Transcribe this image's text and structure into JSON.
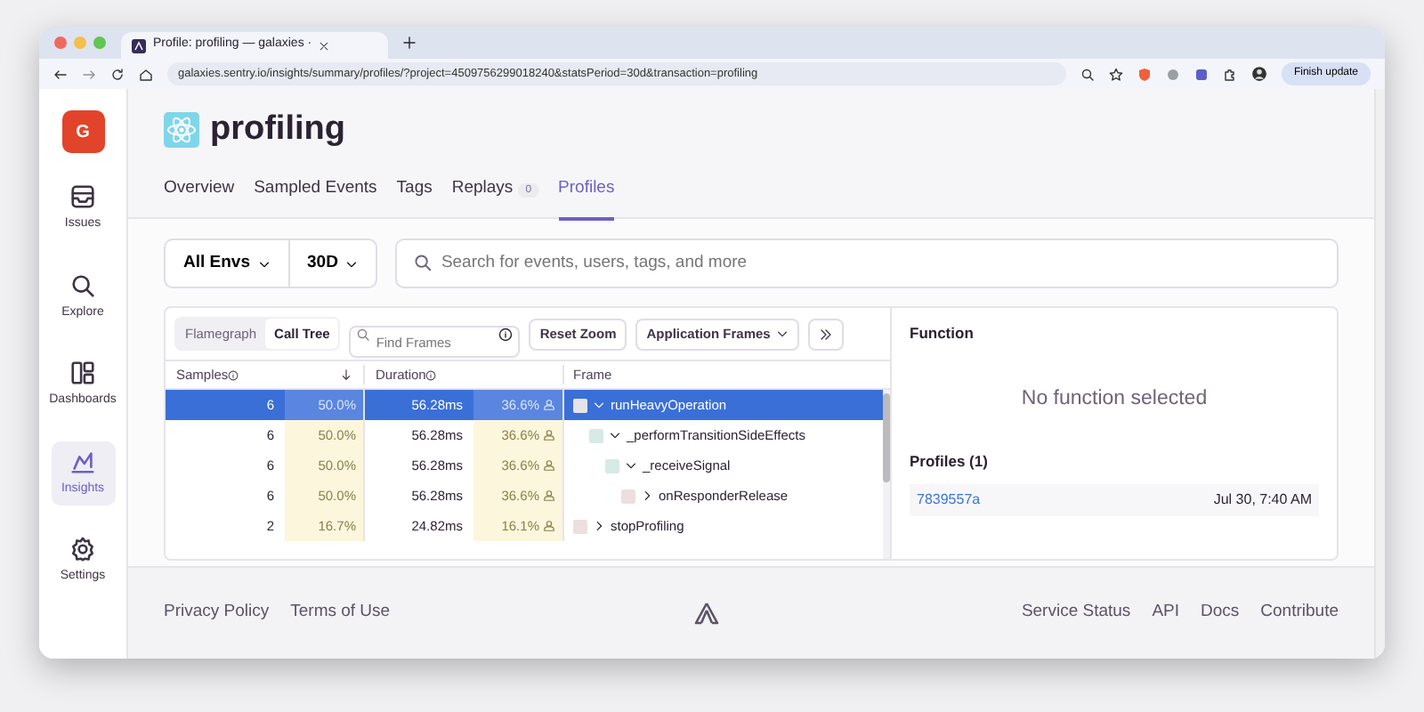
{
  "browser": {
    "tab_title": "Profile: profiling — galaxies ·",
    "address": "galaxies.sentry.io/insights/summary/profiles/?project=4509756299018240&statsPeriod=30d&transaction=profiling",
    "update_button": "Finish update"
  },
  "sidebar": {
    "org": "G",
    "items": [
      {
        "label": "Issues",
        "kind": "inbox",
        "selected": false
      },
      {
        "label": "Explore",
        "kind": "search",
        "selected": false
      },
      {
        "label": "Dashboards",
        "kind": "dashboard",
        "selected": false
      },
      {
        "label": "Insights",
        "kind": "chart",
        "selected": true
      },
      {
        "label": "Settings",
        "kind": "settings",
        "selected": false
      }
    ]
  },
  "page": {
    "title": "profiling",
    "tabs": [
      {
        "label": "Overview",
        "selected": false
      },
      {
        "label": "Sampled Events",
        "selected": false
      },
      {
        "label": "Tags",
        "selected": false
      },
      {
        "label": "Replays",
        "badge": "0",
        "selected": false
      },
      {
        "label": "Profiles",
        "selected": true
      }
    ]
  },
  "filters": {
    "environment": "All Envs",
    "period": "30D",
    "search": {
      "placeholder": "Search for events, users, tags, and more"
    }
  },
  "toolbar": {
    "views": [
      {
        "label": "Flamegraph",
        "selected": false
      },
      {
        "label": "Call Tree",
        "selected": true
      }
    ],
    "find": {
      "placeholder": "Find Frames"
    },
    "reset_button": "Reset Zoom",
    "frames_dropdown": "Application Frames"
  },
  "table": {
    "columns": [
      "Samples",
      "Duration",
      "Frame"
    ],
    "rows": [
      {
        "samples": "6",
        "samples_pct": "50.0%",
        "duration": "56.28ms",
        "duration_pct": "36.6%",
        "frame": "runHeavyOperation",
        "color": "#e6e4ea",
        "expanded": true,
        "selected": true,
        "children": [
          {
            "samples": "6",
            "samples_pct": "50.0%",
            "duration": "56.28ms",
            "duration_pct": "36.6%",
            "frame": "_performTransitionSideEffects",
            "color": "#d6ebe5",
            "expanded": true,
            "selected": false,
            "children": [
              {
                "samples": "6",
                "samples_pct": "50.0%",
                "duration": "56.28ms",
                "duration_pct": "36.6%",
                "frame": "_receiveSignal",
                "color": "#d6ebe5",
                "expanded": true,
                "selected": false,
                "children": [
                  {
                    "samples": "6",
                    "samples_pct": "50.0%",
                    "duration": "56.28ms",
                    "duration_pct": "36.6%",
                    "frame": "onResponderRelease",
                    "color": "#ecdfe0",
                    "expanded": false,
                    "selected": false
                  }
                ]
              }
            ]
          }
        ]
      },
      {
        "samples": "2",
        "samples_pct": "16.7%",
        "duration": "24.82ms",
        "duration_pct": "16.1%",
        "frame": "stopProfiling",
        "color": "#ecdfe0",
        "expanded": false,
        "selected": false
      }
    ]
  },
  "details": {
    "title": "Function",
    "empty_message": "No function selected",
    "profiles_title": "Profiles (1)",
    "profiles": [
      {
        "id": "7839557a",
        "date": "Jul 30, 7:40 AM"
      }
    ]
  },
  "footer": {
    "left_links": [
      "Privacy Policy",
      "Terms of Use"
    ],
    "right_links": [
      "Service Status",
      "API",
      "Docs",
      "Contribute"
    ]
  }
}
